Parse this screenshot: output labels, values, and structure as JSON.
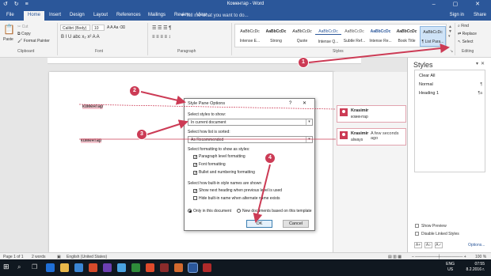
{
  "window": {
    "title": "Коментар - Word",
    "quick_access": "↺ ↻ ≡",
    "controls": "– ▢ ✕"
  },
  "tabs": [
    "File",
    "Home",
    "Insert",
    "Design",
    "Layout",
    "References",
    "Mailings",
    "Review",
    "View"
  ],
  "tell_me": "Tell me what you want to do...",
  "sign_in": "Sign in",
  "share": "Share",
  "ribbon": {
    "clipboard": {
      "label": "Clipboard",
      "paste": "Paste",
      "cut": "Cut",
      "copy": "Copy",
      "format_painter": "Format Painter"
    },
    "font": {
      "label": "Font",
      "name": "Calibri (Body)",
      "size": "10",
      "row2": "B  I  U  abc  x₂  x²  A  A"
    },
    "paragraph": {
      "label": "Paragraph",
      "row1": "☰  ☰  ☰   ¶",
      "row2": "≡  ≡  ≡  ≡   ↕"
    },
    "styles": {
      "label": "Styles",
      "items": [
        {
          "preview": "AaBbCcDc",
          "name": "Intense E..."
        },
        {
          "preview": "AaBbCcDc",
          "name": "Strong"
        },
        {
          "preview": "AaBbCcDc",
          "name": "Quote"
        },
        {
          "preview": "AaBbCcDc",
          "name": "Intense Q..."
        },
        {
          "preview": "AaBbCcDc",
          "name": "Subtle Ref..."
        },
        {
          "preview": "AaBbCcDc",
          "name": "Intense Re..."
        },
        {
          "preview": "AaBbCcDc",
          "name": "Book Title"
        },
        {
          "preview": "AaBbCcDc",
          "name": "¶ List Para..."
        }
      ]
    },
    "editing": {
      "label": "Editing",
      "find": "Find",
      "replace": "Replace",
      "select": "Select"
    }
  },
  "document": {
    "words": [
      "коментар",
      "коментар"
    ]
  },
  "comments": [
    {
      "author": "Krasimir",
      "time": "",
      "body": "коментар"
    },
    {
      "author": "Krasimir",
      "time": "A few seconds ago",
      "body": "always"
    }
  ],
  "styles_pane": {
    "title": "Styles",
    "items": [
      {
        "label": "Clear All",
        "mark": ""
      },
      {
        "label": "Normal",
        "mark": "¶"
      },
      {
        "label": "Heading 1",
        "mark": "¶a"
      }
    ],
    "show_preview": "Show Preview",
    "disable_linked": "Disable Linked Styles",
    "options": "Options..."
  },
  "dialog": {
    "title": "Style Pane Options",
    "controls": "? ✕",
    "select_styles_label": "Select styles to show:",
    "select_styles_value": "In current document",
    "sort_label": "Select how list is sorted:",
    "sort_value": "As Recommended",
    "formatting_label": "Select formatting to show as styles:",
    "checks": [
      {
        "label": "Paragraph level formatting",
        "checked": true
      },
      {
        "label": "Font formatting",
        "checked": true
      },
      {
        "label": "Bullet and numbering formatting",
        "checked": true
      }
    ],
    "builtin_label": "Select how built-in style names are shown",
    "checks2": [
      {
        "label": "Show next heading when previous level is used",
        "checked": true
      },
      {
        "label": "Hide built-in name when alternate name exists",
        "checked": false
      }
    ],
    "radio_only": "Only in this document",
    "radio_new": "New documents based on this template",
    "ok": "OK",
    "cancel": "Cancel"
  },
  "status": {
    "page": "Page 1 of 1",
    "words": "2 words",
    "language": "English (United States)",
    "zoom": "100 %"
  },
  "taskbar": {
    "lang1": "ENG",
    "lang2": "US",
    "time": "07:55",
    "date": "8.2.2016 г."
  },
  "markers": [
    "1",
    "2",
    "3",
    "4"
  ],
  "colors": {
    "brand": "#2b579a",
    "accent": "#cc3b55"
  }
}
